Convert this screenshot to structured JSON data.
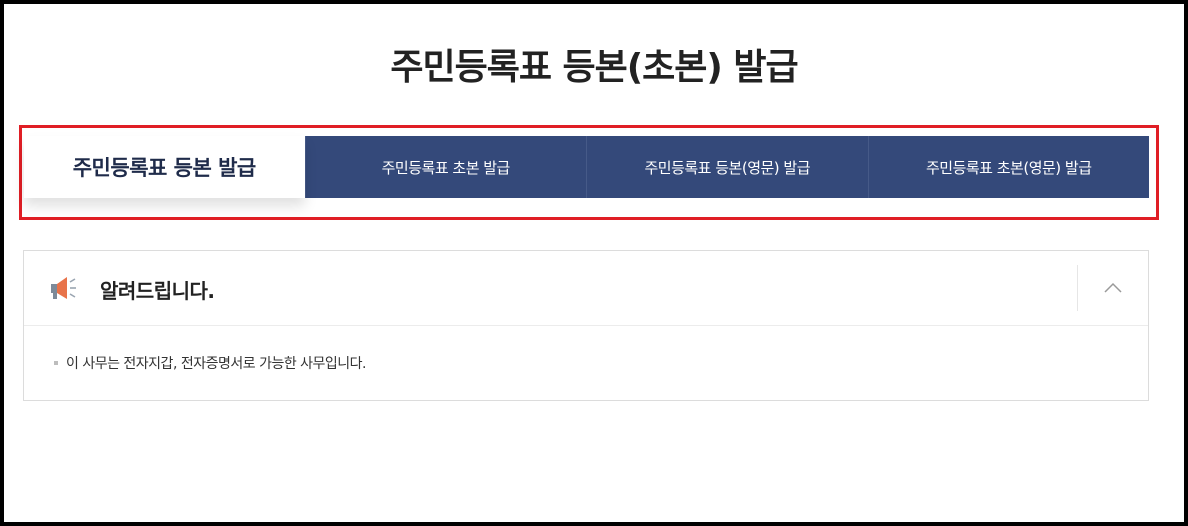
{
  "page": {
    "title": "주민등록표 등본(초본) 발급"
  },
  "tabs": [
    {
      "label": "주민등록표 등본 발급",
      "active": true
    },
    {
      "label": "주민등록표 초본 발급",
      "active": false
    },
    {
      "label": "주민등록표 등본(영문) 발급",
      "active": false
    },
    {
      "label": "주민등록표 초본(영문) 발급",
      "active": false
    }
  ],
  "notice": {
    "icon": "megaphone-icon",
    "title": "알려드립니다.",
    "toggle_icon": "chevron-up-icon",
    "items": [
      "이 사무는 전자지갑, 전자증명서로 가능한 사무입니다."
    ]
  },
  "colors": {
    "tab_bg": "#34497a",
    "tab_active_text": "#1f2b4a",
    "highlight": "#e01e25"
  }
}
